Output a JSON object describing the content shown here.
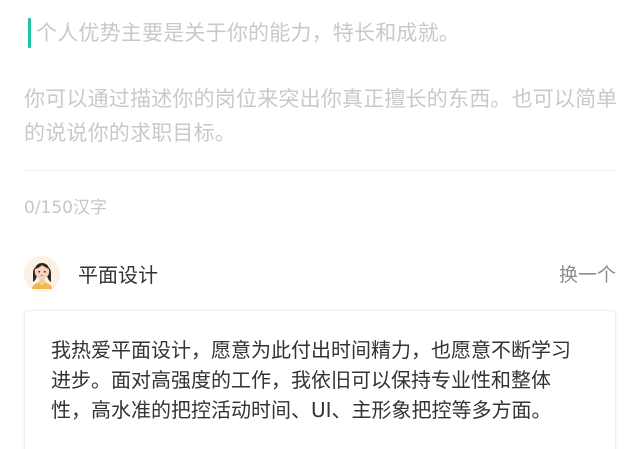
{
  "editor": {
    "placeholder_line1": "个人优势主要是关于你的能力，特长和成就。",
    "placeholder_line2": "你可以通过描述你的岗位来突出你真正擅长的东西。也可以简单的说说你的求职目标。",
    "accent_color": "#1fc3a3"
  },
  "counter": {
    "text": "0/150汉字"
  },
  "example": {
    "avatar_icon": "girl-avatar-icon",
    "title": "平面设计",
    "swap_label": "换一个",
    "text": "我热爱平面设计，愿意为此付出时间精力，也愿意不断学习进步。面对高强度的工作，我依旧可以保持专业性和整体性，高水准的把控活动时间、UI、主形象把控等多方面。"
  }
}
